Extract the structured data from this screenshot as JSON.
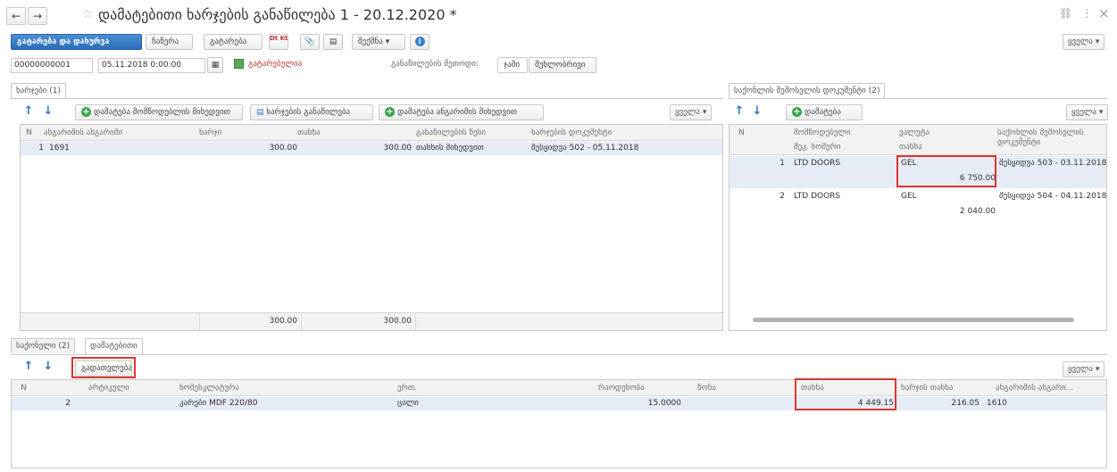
{
  "window": {
    "title": "დამატებითი ხარჯების განაწილება 1 - 20.12.2020 *",
    "star_glyph": "☆",
    "link_glyph": "🔗",
    "menu_glyph": "⋮",
    "close_glyph": "×",
    "back_glyph": "←",
    "forward_glyph": "→"
  },
  "toolbar": {
    "post_close": "გატარება და დახურვა",
    "save": "ჩაწერა",
    "post": "გატარება",
    "dtkt": "Dt Kt",
    "attach_glyph": "📎",
    "doc_glyph": "▤",
    "create_based": "შექმნა",
    "create_arrow": "▾",
    "info_glyph": "i",
    "more": "ყველა"
  },
  "header": {
    "number": "00000000001",
    "date": "05.11.2018 0:00:00",
    "calendar_glyph": "▦",
    "posted_status": "გატარებულია",
    "method_label": "განაწილების მეთოდი:",
    "method_options": [
      "ჯამი",
      "მუხლობრივი"
    ],
    "accent_color": "#2b6cb8",
    "highlight_color": "#d9382f"
  },
  "expenses_panel": {
    "tab": "ხარჯები (1)",
    "add_supplier": "დამატება მომწოდებლის მიხედვით",
    "distribute": "ხარჯების განაწილება",
    "add_purchase": "დამატება ანგარიშის მიხედვით",
    "more": "ყველა",
    "columns": [
      "N",
      "ანგარიშის ანგარიში",
      "ხარჯი",
      "თანხა",
      "განაწილების წესი",
      "ხარჯების დოკუმენტი"
    ],
    "rows": [
      {
        "n": "1",
        "account": "1691",
        "expense": "300.00",
        "amount": "300.00",
        "rule": "თანხის მიხედვით",
        "doc": "შესყიდვა 502 - 05.11.2018"
      }
    ],
    "footer_expense": "300.00",
    "footer_amount": "300.00"
  },
  "receipts_panel": {
    "tab": "საქონლის შემოსვლის დოკუმენტი (2)",
    "add": "დამატება",
    "more": "ყველა",
    "columns": [
      "N",
      "მომწოდებელი",
      "ვალუტა",
      "საქონლის შემოსვლის დოკუმენტი"
    ],
    "columns_sub": [
      "",
      "შეკ. ნომერი",
      "თანხა",
      ""
    ],
    "rows": [
      {
        "n": "1",
        "supplier": "LTD DOORS",
        "currency": "GEL",
        "amount": "6 750.00",
        "doc": "შესყიდვა 503 - 03.11.2018"
      },
      {
        "n": "2",
        "supplier": "LTD DOORS",
        "currency": "GEL",
        "amount": "2 040.00",
        "doc": "შესყიდვა 504 - 04.11.2018"
      }
    ]
  },
  "bottom_panel": {
    "tabs": [
      "საქონელი (2)",
      "დამატებითი"
    ],
    "recalc": "გადათვლება",
    "more": "ყველა",
    "columns": [
      "N",
      "არტიკული",
      "ნომენკლატურა",
      "ერთ.",
      "რაოდენობა",
      "წონა",
      "თანხა",
      "ხარჯის თანხა",
      "ანგარიშის ანგარი..."
    ],
    "rows": [
      {
        "n": "2",
        "article": "",
        "nomenclature": "კარები MDF 220/80",
        "unit": "ცალი",
        "qty": "15.0000",
        "weight": "",
        "amount": "4 449.15",
        "expense": "216.05",
        "account": "1610"
      }
    ]
  }
}
